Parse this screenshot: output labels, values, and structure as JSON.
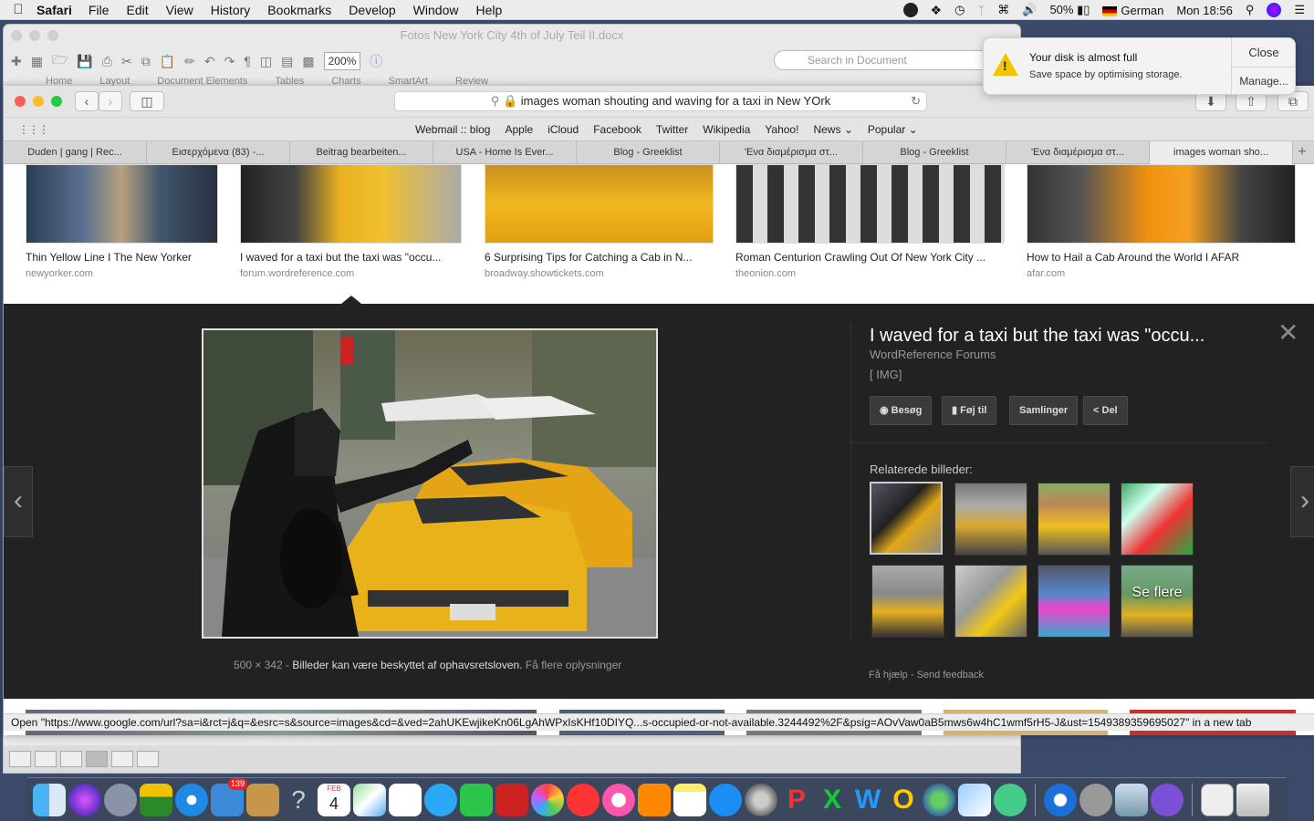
{
  "menubar": {
    "app": "Safari",
    "items": [
      "File",
      "Edit",
      "View",
      "History",
      "Bookmarks",
      "Develop",
      "Window",
      "Help"
    ],
    "battery": "50%",
    "language": "German",
    "clock": "Mon 18:56"
  },
  "word": {
    "title": "Fotos New York City 4th of July Teil II.docx",
    "zoom": "200%",
    "search_placeholder": "Search in Document",
    "ribbon_tabs": [
      "Home",
      "Layout",
      "Document Elements",
      "Tables",
      "Charts",
      "SmartArt",
      "Review"
    ]
  },
  "safari": {
    "address": "images woman shouting and waving for a taxi in New YOrk",
    "favorites": [
      "Webmail :: blog",
      "Apple",
      "iCloud",
      "Facebook",
      "Twitter",
      "Wikipedia",
      "Yahoo!",
      "News",
      "Popular"
    ],
    "tabs": [
      "Duden | gang | Rec...",
      "Εισερχόμενα (83) -...",
      "Beitrag bearbeiten...",
      "USA - Home Is Ever...",
      "Blog - Greeklist",
      "'Ενα διαμέρισμα στ...",
      "Blog - Greeklist",
      "'Ενα διαμέρισμα στ...",
      "images woman sho..."
    ],
    "active_tab": 8
  },
  "results": [
    {
      "caption": "Thin Yellow Line I The New Yorker",
      "source": "newyorker.com"
    },
    {
      "caption": "I waved for a taxi but the taxi was \"occu...",
      "source": "forum.wordreference.com"
    },
    {
      "caption": "6 Surprising Tips for Catching a Cab in N...",
      "source": "broadway.showtickets.com"
    },
    {
      "caption": "Roman Centurion Crawling Out Of New York City ...",
      "source": "theonion.com"
    },
    {
      "caption": "How to Hail a Cab Around the World I AFAR",
      "source": "afar.com"
    }
  ],
  "detail": {
    "title": "I waved for a taxi but the taxi was \"occu...",
    "site": "WordReference Forums",
    "img_tag": "[ IMG]",
    "actions": [
      "Besøg",
      "Føj til",
      "Samlinger",
      "Del"
    ],
    "related_label": "Relaterede billeder:",
    "see_more": "Se flere",
    "dimensions": "500 × 342",
    "separator": " - ",
    "copyright": "Billeder kan være beskyttet af ophavsretsloven.",
    "more_info": "Få flere oplysninger",
    "help": "Få hjælp",
    "feedback": "Send feedback",
    "help_sep": " - "
  },
  "statusbar": "Open \"https://www.google.com/url?sa=i&rct=j&q=&esrc=s&source=images&cd=&ved=2ahUKEwjikeKn06LgAhWPxIsKHf10DIYQ...s-occupied-or-not-available.3244492%2F&psig=AOvVaw0aB5mws6w4hC1wmf5rH5-J&ust=1549389359695027\" in a new tab",
  "notification": {
    "title": "Your disk is almost full",
    "body": "Save space by optimising storage.",
    "close": "Close",
    "manage": "Manage..."
  },
  "dock": {
    "calendar_month": "FEB",
    "calendar_day": "4",
    "badge": "139"
  }
}
